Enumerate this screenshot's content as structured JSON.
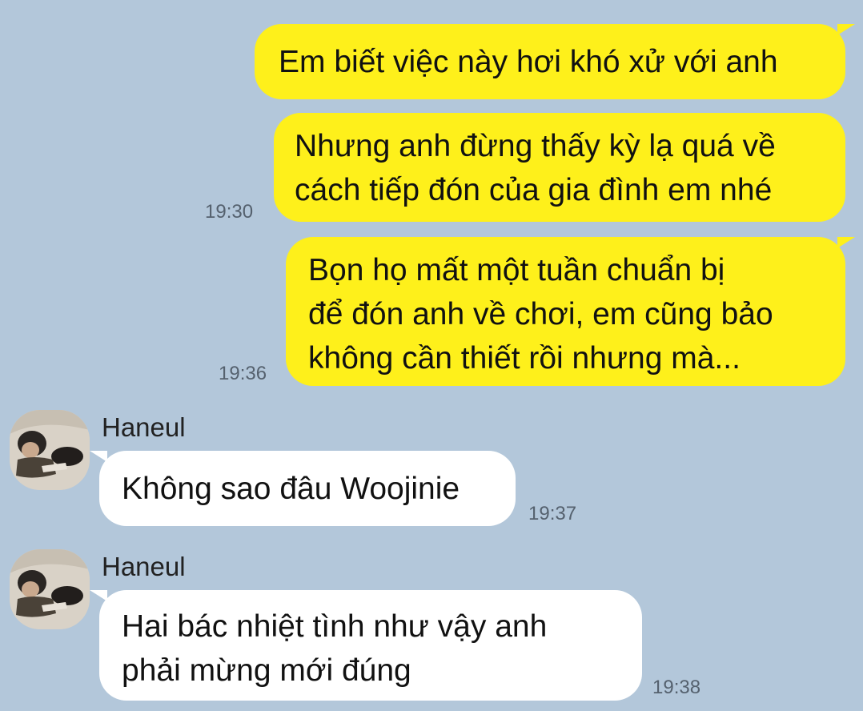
{
  "contact": {
    "name": "Haneul"
  },
  "messages": [
    {
      "direction": "out",
      "lines": [
        "Em biết việc này hơi khó xử với anh"
      ],
      "time": ""
    },
    {
      "direction": "out",
      "lines": [
        "Nhưng anh đừng thấy kỳ lạ quá về",
        "cách tiếp đón của gia đình em nhé"
      ],
      "time": "19:30"
    },
    {
      "direction": "out",
      "lines": [
        "Bọn họ mất một tuần chuẩn bị",
        "để đón anh về chơi, em cũng bảo",
        "không cần thiết rồi nhưng mà..."
      ],
      "time": "19:36"
    },
    {
      "direction": "in",
      "sender": "Haneul",
      "lines": [
        "Không sao đâu Woojinie"
      ],
      "time": "19:37"
    },
    {
      "direction": "in",
      "sender": "Haneul",
      "lines": [
        "Hai bác nhiệt tình như vậy anh",
        "phải mừng mới đúng"
      ],
      "time": "19:38"
    }
  ],
  "colors": {
    "background": "#b3c7da",
    "outgoing_bubble": "#fef01b",
    "incoming_bubble": "#ffffff",
    "timestamp": "#55616e"
  },
  "icons": {
    "avatar": "profile-photo"
  }
}
